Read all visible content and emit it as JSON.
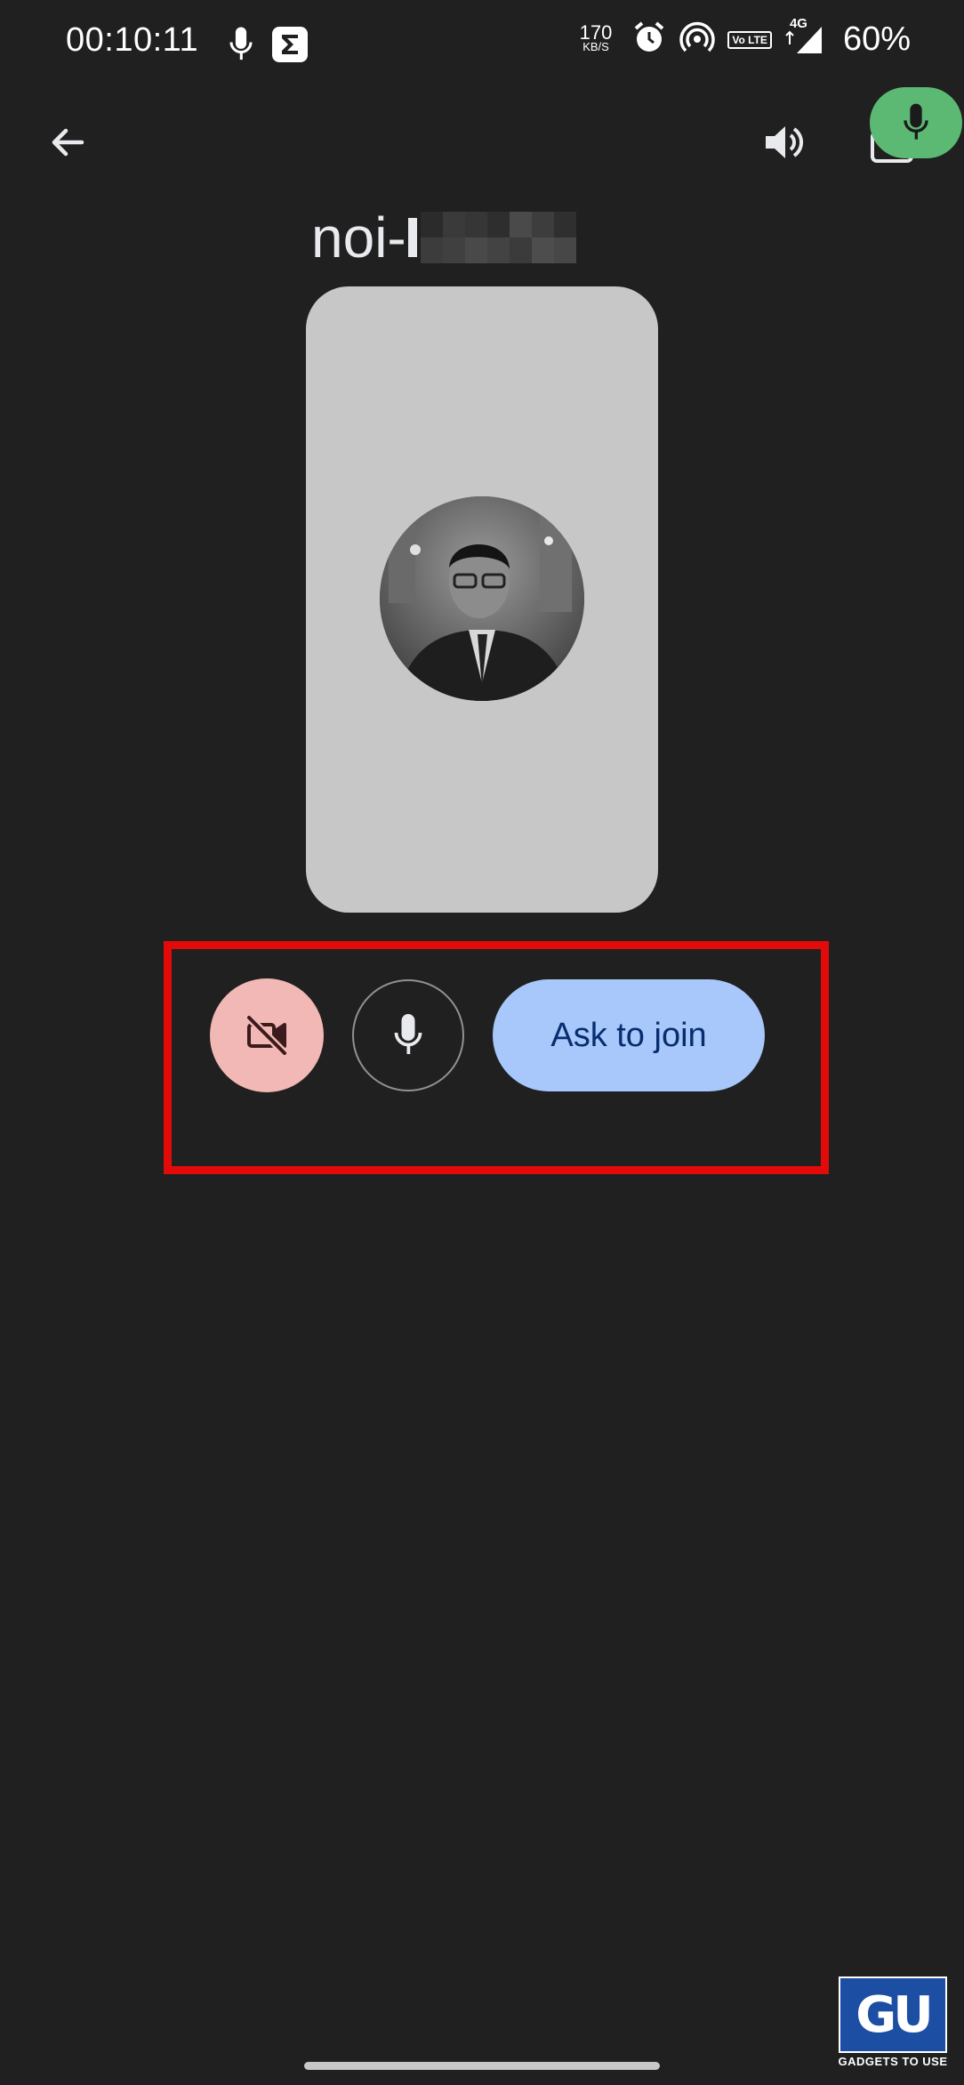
{
  "status_bar": {
    "time": "00:10:11",
    "net_speed_value": "170",
    "net_speed_unit": "KB/S",
    "volte_label": "Vo LTE",
    "network_type": "4G",
    "battery": "60%"
  },
  "toolbar": {
    "back_icon": "arrow-back-icon",
    "speaker_icon": "volume-up-icon",
    "switch_camera_icon": "switch-camera-icon",
    "voice_input_icon": "mic-icon"
  },
  "meeting": {
    "code_visible": "noi-"
  },
  "controls": {
    "camera_icon": "videocam-off-icon",
    "mic_icon": "mic-icon",
    "join_label": "Ask to join"
  },
  "watermark": {
    "logo_text": "GU",
    "text": "GADGETS TO USE"
  },
  "colors": {
    "background": "#202020",
    "preview_tile": "#c6c7c6",
    "camera_off_button": "#f2b8b5",
    "join_button": "#a8c7fa",
    "join_text": "#062e6f",
    "highlight_box": "#e30a0a",
    "voice_chip": "#5bb974"
  }
}
